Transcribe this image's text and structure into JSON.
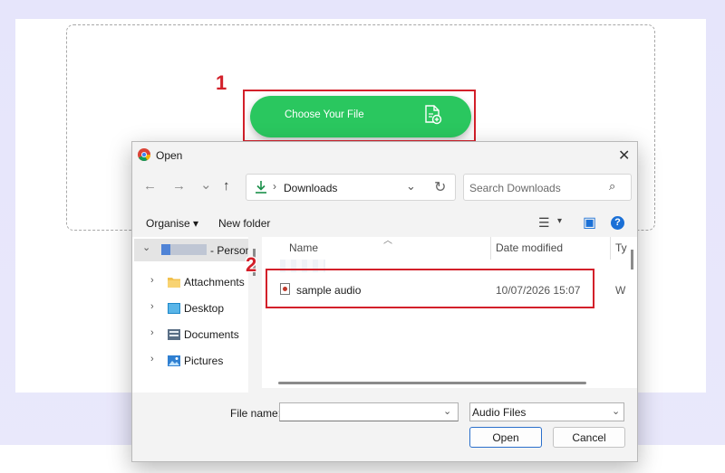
{
  "background": {
    "choose_button_label": "Choose Your File",
    "annotation_1": "1",
    "annotation_2": "2"
  },
  "dialog": {
    "title": "Open",
    "close_glyph": "✕",
    "nav": {
      "back": "←",
      "forward": "→",
      "recent": "⌄",
      "up": "↑"
    },
    "address": {
      "separator": "›",
      "path": "Downloads",
      "dropdown": "⌄",
      "refresh": "↻"
    },
    "search": {
      "placeholder": "Search Downloads",
      "icon": "⌕"
    },
    "toolbar": {
      "organise": "Organise ▾",
      "new_folder": "New folder",
      "view_icon": "☰",
      "view_caret": "▾",
      "pane_icon": "▣",
      "help": "?"
    },
    "navigation": {
      "top_item_suffix": "- Persona",
      "items": [
        {
          "label": "Attachments",
          "icon": "folder-icon"
        },
        {
          "label": "Desktop",
          "icon": "desktop-icon"
        },
        {
          "label": "Documents",
          "icon": "documents-icon"
        },
        {
          "label": "Pictures",
          "icon": "pictures-icon"
        }
      ],
      "expand_glyph": "›",
      "expanded_glyph": "⌄"
    },
    "files": {
      "columns": [
        "Name",
        "Date modified",
        "Ty"
      ],
      "rows": [
        {
          "name": "sample audio",
          "date": "10/07/2026 15:07",
          "type": "W"
        }
      ]
    },
    "bottom": {
      "file_name_label": "File name:",
      "file_name_value": "",
      "dropdown_caret": "⌄",
      "filter_value": "Audio Files",
      "open_label": "Open",
      "cancel_label": "Cancel"
    }
  },
  "colors": {
    "accent_green": "#2ac75f",
    "annotation_red": "#d3202a",
    "help_blue": "#1b70d6"
  }
}
